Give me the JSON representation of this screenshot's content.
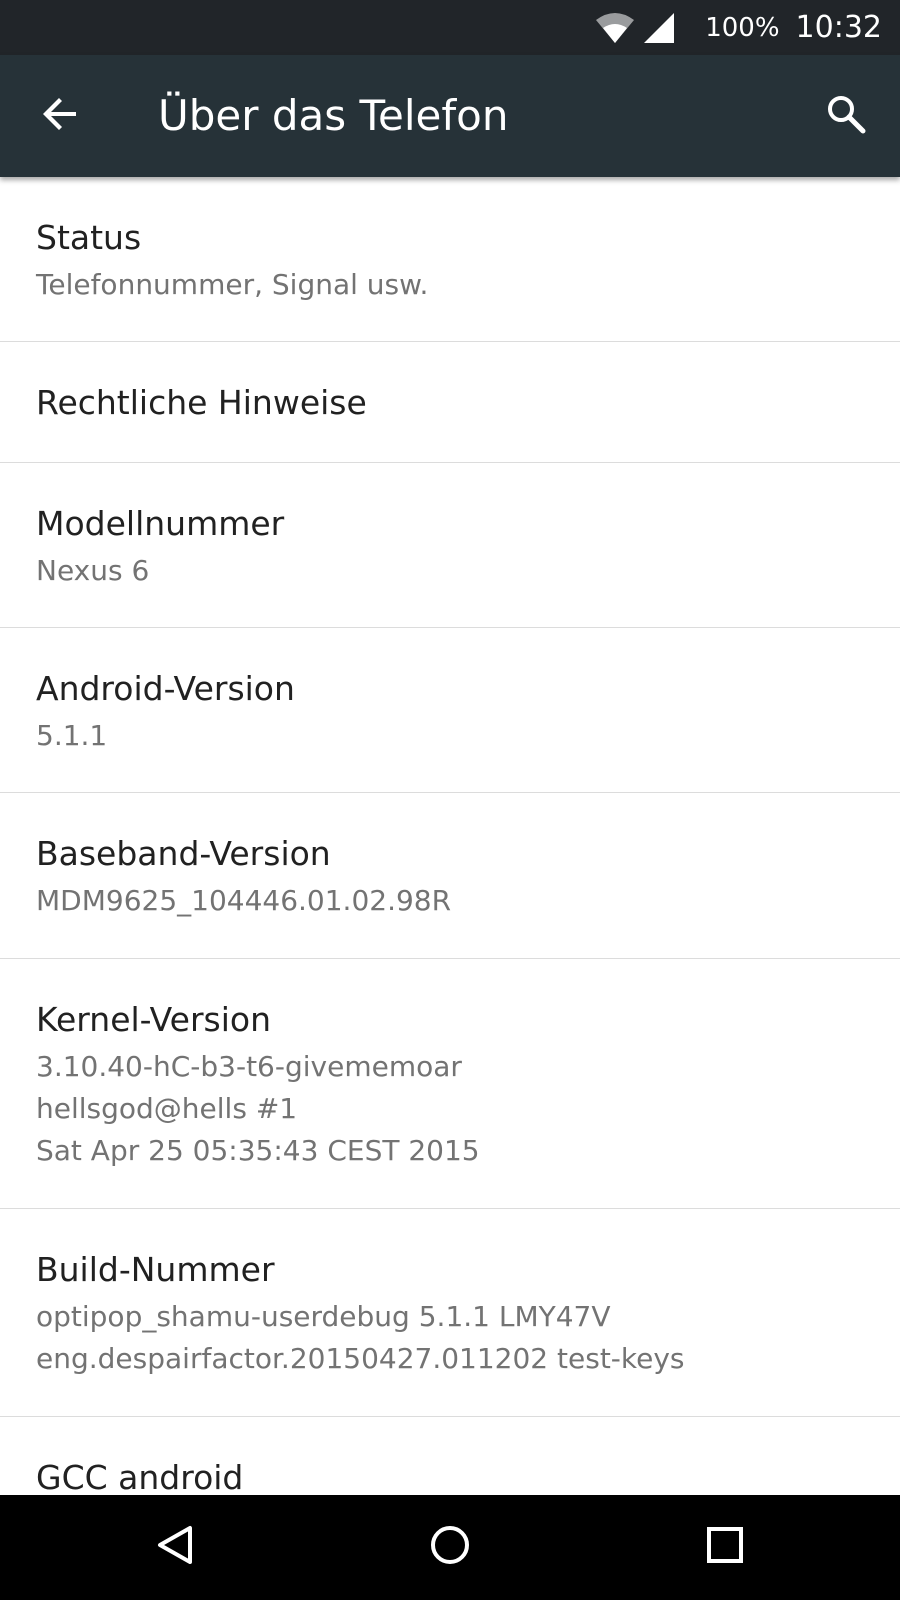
{
  "status_bar": {
    "battery": "100%",
    "time": "10:32"
  },
  "app_bar": {
    "title": "Über das Telefon",
    "back_icon": "arrow-back-icon",
    "search_icon": "search-icon"
  },
  "items": [
    {
      "title": "Status",
      "summary": [
        "Telefonnummer, Signal usw."
      ]
    },
    {
      "title": "Rechtliche Hinweise",
      "summary": []
    },
    {
      "title": "Modellnummer",
      "summary": [
        "Nexus 6"
      ]
    },
    {
      "title": "Android-Version",
      "summary": [
        "5.1.1"
      ]
    },
    {
      "title": "Baseband-Version",
      "summary": [
        "MDM9625_104446.01.02.98R"
      ]
    },
    {
      "title": "Kernel-Version",
      "summary": [
        "3.10.40-hC-b3-t6-givememoar",
        "hellsgod@hells #1",
        "Sat Apr 25 05:35:43 CEST 2015"
      ]
    },
    {
      "title": "Build-Nummer",
      "summary": [
        "optipop_shamu-userdebug 5.1.1 LMY47V",
        "eng.despairfactor.20150427.011202 test-keys"
      ]
    },
    {
      "title": "GCC android",
      "summary": []
    }
  ],
  "nav_bar": {
    "back": "nav-back-icon",
    "home": "nav-home-icon",
    "recents": "nav-recents-icon"
  }
}
